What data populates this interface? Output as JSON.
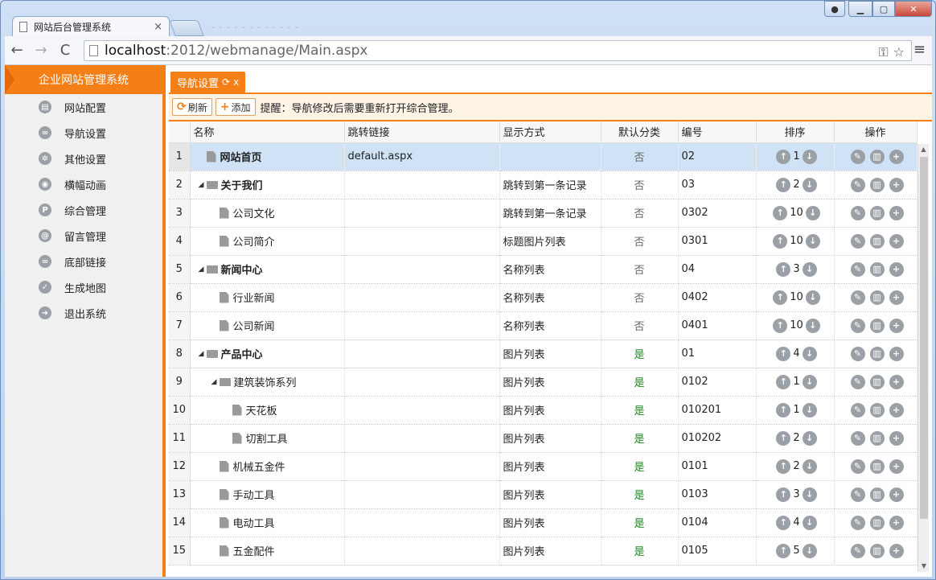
{
  "browser": {
    "tab_title": "网站后台管理系统",
    "tab_close": "×",
    "ghost_tabs": "- - -  - - -  - - -  - - -",
    "url_host": "localhost",
    "url_rest": ":2012/webmanage/Main.aspx",
    "back": "←",
    "forward": "→",
    "reload": "C"
  },
  "sidebar": {
    "brand": "企业网站管理系统",
    "items": [
      {
        "label": "网站配置",
        "icon": "config-icon"
      },
      {
        "label": "导航设置",
        "icon": "link-icon"
      },
      {
        "label": "其他设置",
        "icon": "gear-icon"
      },
      {
        "label": "横幅动画",
        "icon": "camera-icon"
      },
      {
        "label": "综合管理",
        "icon": "p-icon"
      },
      {
        "label": "留言管理",
        "icon": "at-icon"
      },
      {
        "label": "底部链接",
        "icon": "link-icon"
      },
      {
        "label": "生成地图",
        "icon": "check-icon"
      },
      {
        "label": "退出系统",
        "icon": "arrow-right-icon"
      }
    ]
  },
  "panel": {
    "tab_label": "导航设置",
    "tab_close": "x",
    "refresh_label": "刷新",
    "add_label": "添加",
    "hint": "提醒：导航修改后需要重新打开综合管理。"
  },
  "table": {
    "headers": [
      "名称",
      "跳转链接",
      "显示方式",
      "默认分类",
      "编号",
      "排序",
      "操作"
    ],
    "rows": [
      {
        "no": "1",
        "name": "网站首页",
        "link": "default.aspx",
        "mode": "",
        "def": "否",
        "code": "02",
        "order": "1"
      },
      {
        "no": "2",
        "name": "关于我们",
        "link": "",
        "mode": "跳转到第一条记录",
        "def": "否",
        "code": "03",
        "order": "2"
      },
      {
        "no": "3",
        "name": "公司文化",
        "link": "",
        "mode": "跳转到第一条记录",
        "def": "否",
        "code": "0302",
        "order": "10"
      },
      {
        "no": "4",
        "name": "公司简介",
        "link": "",
        "mode": "标题图片列表",
        "def": "否",
        "code": "0301",
        "order": "10"
      },
      {
        "no": "5",
        "name": "新闻中心",
        "link": "",
        "mode": "名称列表",
        "def": "否",
        "code": "04",
        "order": "3"
      },
      {
        "no": "6",
        "name": "行业新闻",
        "link": "",
        "mode": "名称列表",
        "def": "否",
        "code": "0402",
        "order": "10"
      },
      {
        "no": "7",
        "name": "公司新闻",
        "link": "",
        "mode": "名称列表",
        "def": "否",
        "code": "0401",
        "order": "10"
      },
      {
        "no": "8",
        "name": "产品中心",
        "link": "",
        "mode": "图片列表",
        "def": "是",
        "code": "01",
        "order": "4"
      },
      {
        "no": "9",
        "name": "建筑装饰系列",
        "link": "",
        "mode": "图片列表",
        "def": "是",
        "code": "0102",
        "order": "1"
      },
      {
        "no": "10",
        "name": "天花板",
        "link": "",
        "mode": "图片列表",
        "def": "是",
        "code": "010201",
        "order": "1"
      },
      {
        "no": "11",
        "name": "切割工具",
        "link": "",
        "mode": "图片列表",
        "def": "是",
        "code": "010202",
        "order": "2"
      },
      {
        "no": "12",
        "name": "机械五金件",
        "link": "",
        "mode": "图片列表",
        "def": "是",
        "code": "0101",
        "order": "2"
      },
      {
        "no": "13",
        "name": "手动工具",
        "link": "",
        "mode": "图片列表",
        "def": "是",
        "code": "0103",
        "order": "3"
      },
      {
        "no": "14",
        "name": "电动工具",
        "link": "",
        "mode": "图片列表",
        "def": "是",
        "code": "0104",
        "order": "4"
      },
      {
        "no": "15",
        "name": "五金配件",
        "link": "",
        "mode": "图片列表",
        "def": "是",
        "code": "0105",
        "order": "5"
      }
    ]
  },
  "colors": {
    "accent": "#f57f17",
    "yes": "#1a8a1a",
    "selected": "#cfe2f6"
  }
}
